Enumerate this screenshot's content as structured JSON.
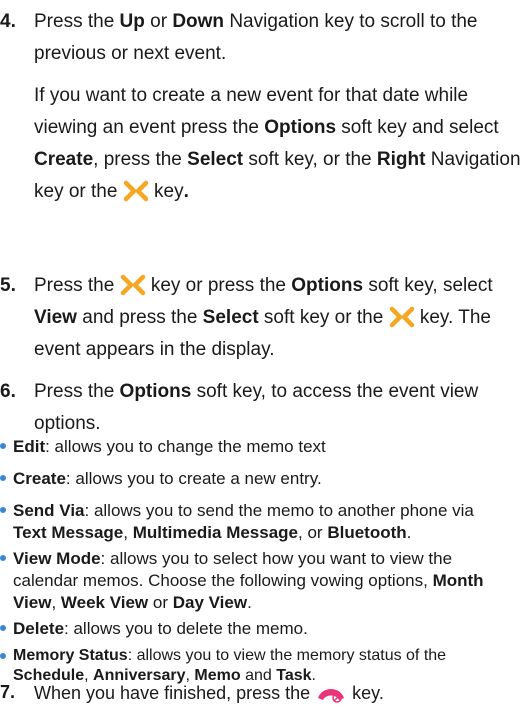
{
  "step4": {
    "num": "4.",
    "a1": "Press the ",
    "up": "Up",
    "a2": " or ",
    "down": "Down",
    "a3": " Navigation key to scroll to the previous or next event.",
    "b1": "If you want to create a new event for that date while viewing an event press the ",
    "options": "Options",
    "b2": " soft key and select ",
    "create": "Create",
    "b3": ", press the ",
    "select": "Select",
    "b4": " soft key, or the ",
    "right": "Right",
    "b5": " Navigation key or the ",
    "b6": " key",
    "b7": "."
  },
  "step5": {
    "num": "5.",
    "a1": "Press the ",
    "a2": " key or press the ",
    "options": "Options",
    "a3": " soft key, select ",
    "view": "View",
    "a4": " and press the ",
    "select": "Select",
    "a5": " soft key or the ",
    "a6": " key. The event appears in the display."
  },
  "step6": {
    "num": "6.",
    "a1": "Press the ",
    "options": "Options",
    "a2": " soft key, to access the event view options."
  },
  "bullets": {
    "edit": {
      "term": "Edit",
      "text": ": allows you to change the memo text"
    },
    "create": {
      "term": "Create",
      "text": ": allows you to create a new entry."
    },
    "send_via": {
      "term": "Send Via",
      "text1": ": allows you to send the memo to another phone via",
      "text_msg": "Text Message",
      "sep1": ", ",
      "mms": "Multimedia Message",
      "sep2": ", or ",
      "bt": "Bluetooth",
      "end": "."
    },
    "view_mode": {
      "term": "View Mode",
      "text1": ": allows you to select how you want to view the",
      "text2": "calendar memos. Choose the following vowing options, ",
      "month": "Month",
      "month_view": "View",
      "sep1": ", ",
      "week": "Week View",
      "sep2": " or ",
      "day": "Day View",
      "end": "."
    },
    "delete": {
      "term": "Delete",
      "text": ": allows you to delete the memo."
    },
    "memory": {
      "term": "Memory Status",
      "text1": ": allows you to view the memory status of the",
      "schedule": "Schedule",
      "sep1": ", ",
      "anniversary": "Anniversary",
      "sep2": ", ",
      "memo": "Memo",
      "sep3": " and ",
      "task": "Task",
      "end": "."
    }
  },
  "step7": {
    "num": "7.",
    "a1": "When you have finished, press the ",
    "a2": " key."
  },
  "icons": {
    "select_key": "x-navigation-key-icon",
    "end_key": "end-call-key-icon",
    "select_key_color": "#f5a623",
    "end_key_color": "#e8347a",
    "bullet_color": "#3a86d4"
  }
}
